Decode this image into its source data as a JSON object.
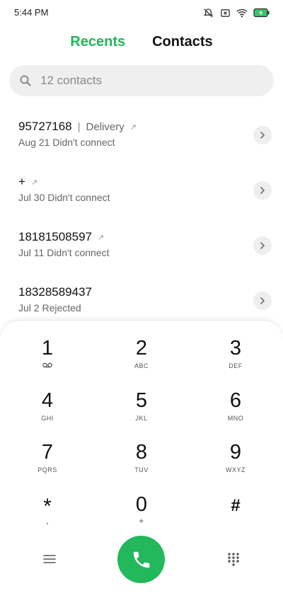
{
  "status_bar": {
    "time": "5:44 PM",
    "icons": [
      "notifications-off-icon",
      "sim-x-icon",
      "wifi-icon",
      "battery-charging-icon"
    ]
  },
  "tabs": [
    {
      "label": "Recents",
      "active": true
    },
    {
      "label": "Contacts",
      "active": false
    }
  ],
  "search": {
    "placeholder": "12 contacts"
  },
  "call_log": [
    {
      "number": "95727168",
      "label": "Delivery",
      "outgoing": true,
      "detail": "Aug 21 Didn't connect"
    },
    {
      "number": "+",
      "label": "",
      "outgoing": true,
      "detail": "Jul 30 Didn't connect"
    },
    {
      "number": "18181508597",
      "label": "",
      "outgoing": true,
      "detail": "Jul 11 Didn't connect"
    },
    {
      "number": "18328589437",
      "label": "",
      "outgoing": false,
      "detail": "Jul 2 Rejected"
    }
  ],
  "dialpad": {
    "keys": [
      {
        "digit": "1",
        "letters": ""
      },
      {
        "digit": "2",
        "letters": "ABC"
      },
      {
        "digit": "3",
        "letters": "DEF"
      },
      {
        "digit": "4",
        "letters": "GHI"
      },
      {
        "digit": "5",
        "letters": "JKL"
      },
      {
        "digit": "6",
        "letters": "MNO"
      },
      {
        "digit": "7",
        "letters": "PQRS"
      },
      {
        "digit": "8",
        "letters": "TUV"
      },
      {
        "digit": "9",
        "letters": "WXYZ"
      },
      {
        "digit": "*",
        "letters": ","
      },
      {
        "digit": "0",
        "letters": "+"
      },
      {
        "digit": "#",
        "letters": ""
      }
    ]
  },
  "colors": {
    "accent": "#23b45a",
    "call_button": "#22b85c"
  }
}
